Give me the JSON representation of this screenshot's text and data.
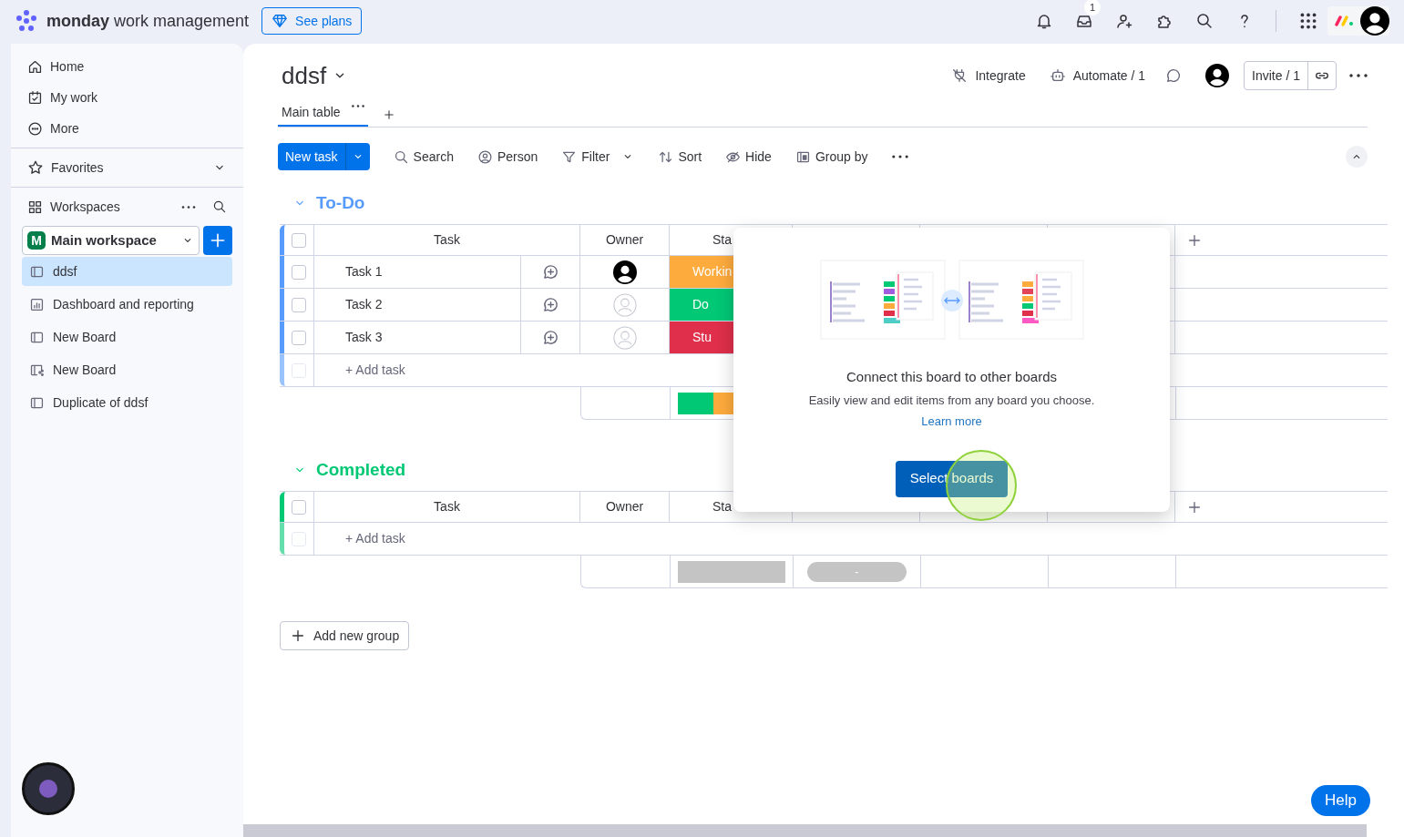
{
  "top_bar": {
    "brand_bold": "monday",
    "brand_rest": "work management",
    "see_plans": "See plans",
    "inbox_badge": "1"
  },
  "sidebar": {
    "nav": [
      {
        "label": "Home",
        "kind": "home"
      },
      {
        "label": "My work",
        "kind": "mywork"
      },
      {
        "label": "More",
        "kind": "more"
      }
    ],
    "favorites": {
      "label": "Favorites",
      "expanded": false
    },
    "workspaces_label": "Workspaces",
    "workspace": {
      "initial": "M",
      "name": "Main workspace"
    },
    "boards": [
      {
        "label": "ddsf",
        "kind": "board",
        "selected": true
      },
      {
        "label": "Dashboard and reporting",
        "kind": "dashboard",
        "selected": false
      },
      {
        "label": "New Board",
        "kind": "board",
        "selected": false
      },
      {
        "label": "New Board",
        "kind": "shared",
        "selected": false
      },
      {
        "label": "Duplicate of ddsf",
        "kind": "board",
        "selected": false
      }
    ]
  },
  "board": {
    "title": "ddsf",
    "actions": {
      "integrate": "Integrate",
      "automate": "Automate / 1",
      "invite": "Invite / 1"
    },
    "views": [
      {
        "label": "Main table",
        "selected": true
      }
    ],
    "toolbar": {
      "new_task": "New task",
      "items": [
        {
          "label": "Search",
          "kind": "search"
        },
        {
          "label": "Person",
          "kind": "person"
        },
        {
          "label": "Filter",
          "kind": "filter"
        },
        {
          "label": "Sort",
          "kind": "sort"
        },
        {
          "label": "Hide",
          "kind": "hide"
        },
        {
          "label": "Group by",
          "kind": "groupby"
        }
      ]
    },
    "groups": [
      {
        "title": "To-Do",
        "color": "#579bfc",
        "columns": [
          "Task",
          "Owner",
          "Sta"
        ],
        "all_checked": false,
        "rows": [
          {
            "task": "Task 1",
            "checked": false,
            "owner_assigned": true,
            "status": "Workin",
            "color": "#fdab3d"
          },
          {
            "task": "Task 2",
            "checked": false,
            "owner_assigned": false,
            "status": "Do",
            "color": "#00c875"
          },
          {
            "task": "Task 3",
            "checked": false,
            "owner_assigned": false,
            "status": "Stu",
            "color": "#df2f4a"
          }
        ],
        "add_task": "+ Add task",
        "summary": {
          "kind": "segments",
          "segments": [
            {
              "color": "#00c875"
            },
            {
              "color": "#fdab3d"
            }
          ]
        }
      },
      {
        "title": "Completed",
        "color": "#00c875",
        "columns": [
          "Task",
          "Owner",
          "Sta"
        ],
        "all_checked": false,
        "add_task": "+ Add task",
        "summary": {
          "kind": "empty",
          "pill": "-"
        }
      }
    ],
    "add_group": "Add new group"
  },
  "popup": {
    "title": "Connect this board to other boards",
    "text": "Easily view and edit items from any board you choose.",
    "link": "Learn more",
    "button": "Select boards"
  },
  "help": "Help"
}
